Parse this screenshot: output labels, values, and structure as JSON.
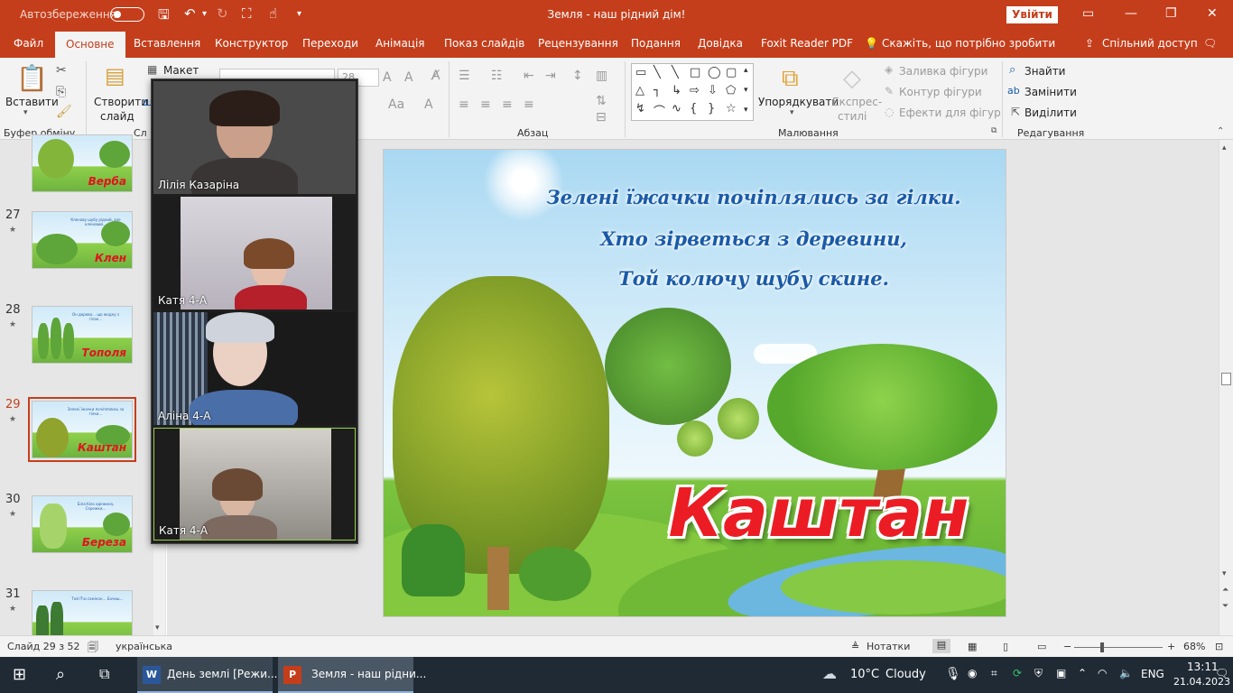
{
  "titlebar": {
    "autosave": "Автозбереження",
    "title": "Земля - наш рідний дім!",
    "signin": "Увійти",
    "icons": [
      "save-icon",
      "undo-icon",
      "redo-icon",
      "present-icon",
      "touch-icon",
      "customize-icon"
    ]
  },
  "tabs": [
    "Файл",
    "Основне",
    "Вставлення",
    "Конструктор",
    "Переходи",
    "Анімація",
    "Показ слайдів",
    "Рецензування",
    "Подання",
    "Довідка",
    "Foxit Reader PDF",
    "Скажіть, що потрібно зробити",
    "Спільний доступ"
  ],
  "ribbon": {
    "paste": "Вставити",
    "clipboard": "Буфер обміну",
    "new_slide_1": "Створити",
    "new_slide_2": "слайд",
    "layout": "Макет",
    "slides_group": "Сл",
    "font_size": "28",
    "paragraph": "Абзац",
    "arrange": "Упорядкувати",
    "quick_styles_1": "Експрес-",
    "quick_styles_2": "стилі",
    "shape_fill": "Заливка фігури",
    "shape_outline": "Контур фігури",
    "shape_effects": "Ефекти для фігур",
    "drawing": "Малювання",
    "find": "Знайти",
    "replace": "Замінити",
    "select": "Виділити",
    "editing": "Редагування"
  },
  "slides": [
    {
      "num": "",
      "title": "Верба"
    },
    {
      "num": "27",
      "title": "Клен"
    },
    {
      "num": "28",
      "title": "Тополя"
    },
    {
      "num": "29",
      "title": "Каштан"
    },
    {
      "num": "30",
      "title": "Береза"
    },
    {
      "num": "31",
      "title": ""
    }
  ],
  "slide": {
    "line1": "Зелені їжачки почіплялись за гілки.",
    "line2": "Хто зірветься з деревини,",
    "line3": "Той колючу шубу скине.",
    "title": "Каштан"
  },
  "video": [
    {
      "name": "Лілія Казаріна"
    },
    {
      "name": "Катя  4-А"
    },
    {
      "name": "Аліна 4-А"
    },
    {
      "name": "Катя 4-А"
    }
  ],
  "status": {
    "slide_info": "Слайд 29 з 52",
    "language": "українська",
    "notes": "Нотатки",
    "zoom": "68%"
  },
  "taskbar": {
    "word": "День землі [Режи...",
    "ppt": "Земля - наш рідни...",
    "weather_temp": "10°C",
    "weather_desc": "Cloudy",
    "lang": "ENG",
    "time": "13:11",
    "date": "21.04.2023"
  }
}
